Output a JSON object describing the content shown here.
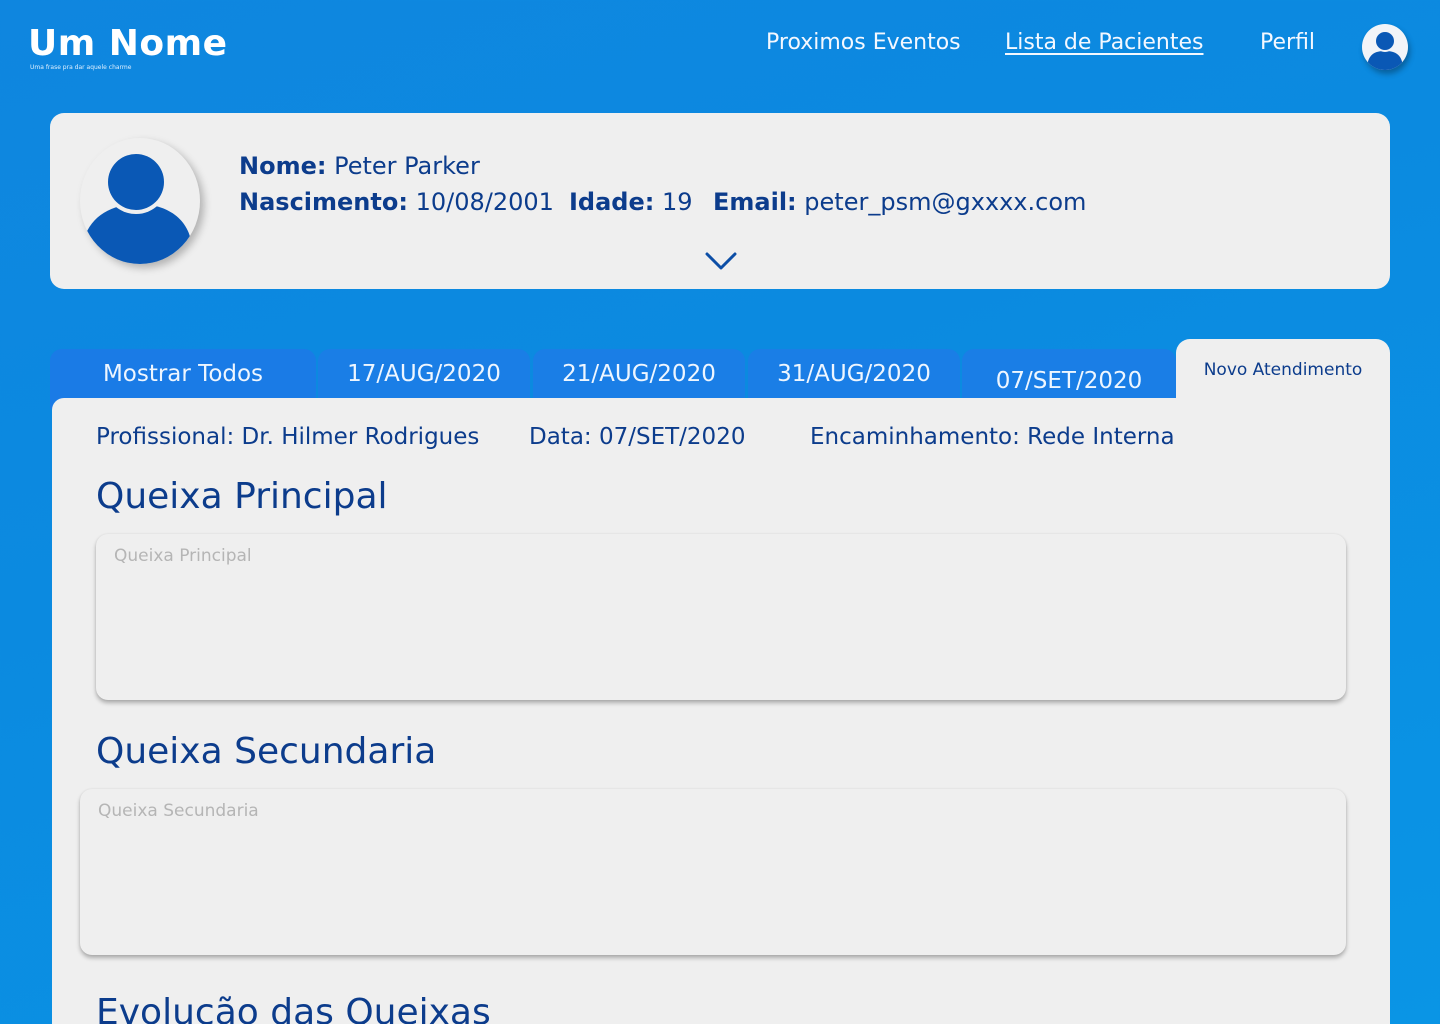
{
  "brand": {
    "title": "Um Nome",
    "tagline": "Uma frase pra dar aquele charme"
  },
  "nav": {
    "items": [
      {
        "label": "Proximos Eventos"
      },
      {
        "label": "Lista de Pacientes",
        "active": true
      },
      {
        "label": "Perfil"
      }
    ],
    "profile_icon": "user-avatar-icon"
  },
  "patient": {
    "avatar_icon": "user-silhouette-icon",
    "nome_label": "Nome:",
    "nome": "Peter Parker",
    "nascimento_label": "Nascimento:",
    "nascimento": "10/08/2001",
    "idade_label": "Idade:",
    "idade": "19",
    "email_label": "Email:",
    "email": "peter_psm@gxxxx.com",
    "expand_icon": "chevron-down-icon"
  },
  "tabs": [
    {
      "label": "Mostrar Todos"
    },
    {
      "label": "17/AUG/2020"
    },
    {
      "label": "21/AUG/2020"
    },
    {
      "label": "31/AUG/2020"
    },
    {
      "label": "07/SET/2020"
    },
    {
      "label": "Novo Atendimento",
      "active": true
    }
  ],
  "atendimento": {
    "profissional": "Profissional: Dr. Hilmer Rodrigues",
    "data": "Data: 07/SET/2020",
    "encaminhamento": "Encaminhamento: Rede Interna",
    "queixa_principal_title": "Queixa Principal",
    "queixa_principal_placeholder": "Queixa Principal",
    "queixa_principal_value": "",
    "queixa_secundaria_title": "Queixa Secundaria",
    "queixa_secundaria_placeholder": "Queixa Secundaria",
    "queixa_secundaria_value": "",
    "evolucao_title": "Evolução das Queixas"
  },
  "colors": {
    "background": "#0b8ae0",
    "primary_text": "#0c3c8c",
    "avatar_blue": "#0a58b5",
    "tab_blue": "#1a7ee6",
    "panel": "#efefef"
  }
}
